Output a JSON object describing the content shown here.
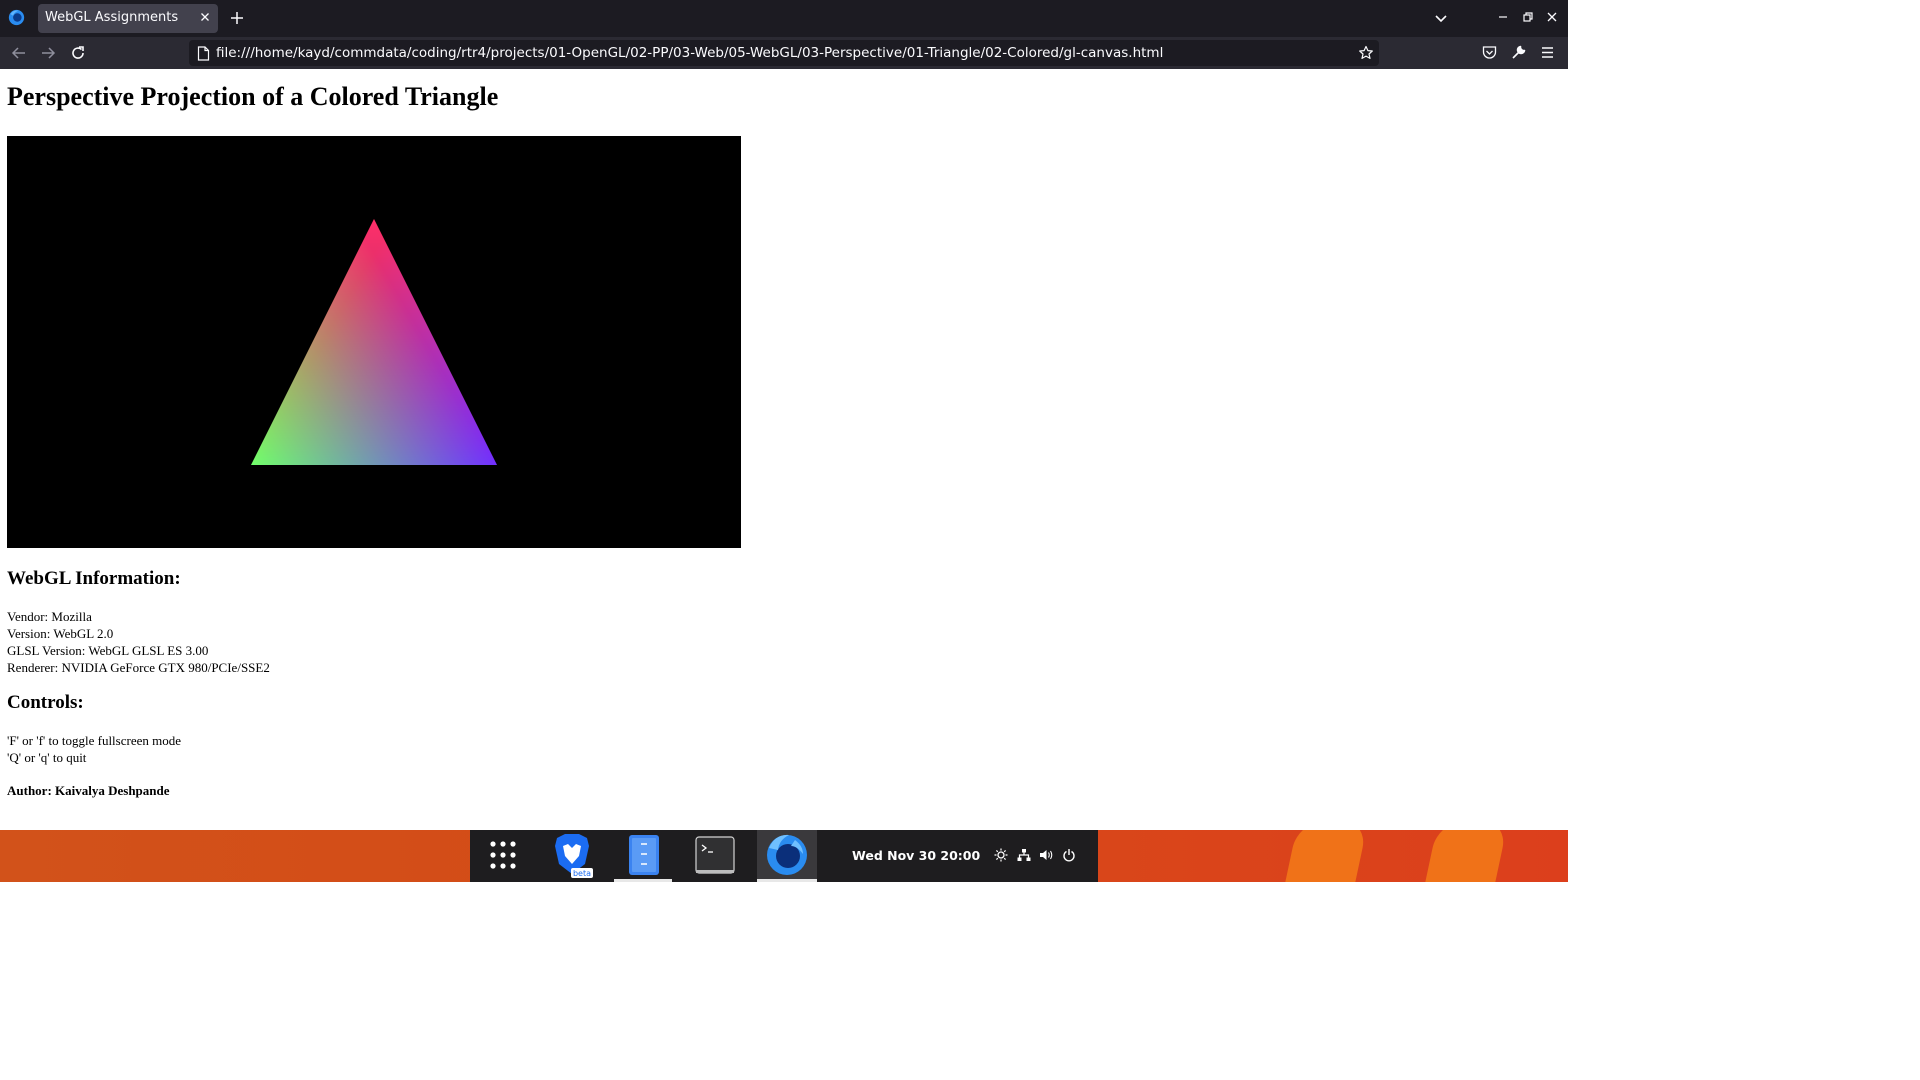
{
  "tab": {
    "title": "WebGL Assignments"
  },
  "navbar": {
    "url": "file:///home/kayd/commdata/coding/rtr4/projects/01-OpenGL/02-PP/03-Web/05-WebGL/03-Perspective/01-Triangle/02-Colored/gl-canvas.html"
  },
  "page": {
    "title": "Perspective Projection of a Colored Triangle",
    "canvas": {
      "background": "#000000",
      "vertex_colors": [
        "#ff0000",
        "#00ff00",
        "#0000ff"
      ]
    },
    "info_heading": "WebGL Information:",
    "info": {
      "vendor": "Vendor: Mozilla",
      "version": "Version: WebGL 2.0",
      "glsl": "GLSL Version: WebGL GLSL ES 3.00",
      "renderer": "Renderer: NVIDIA GeForce GTX 980/PCIe/SSE2"
    },
    "controls_heading": "Controls:",
    "controls": [
      "'F' or 'f' to toggle fullscreen mode",
      "'Q' or 'q' to quit"
    ],
    "author": "Author: Kaivalya Deshpande"
  },
  "taskbar": {
    "clock": "Wed Nov 30  20:00",
    "apps": [
      "apps-grid-icon",
      "brave-browser-icon",
      "file-manager-icon",
      "terminal-icon",
      "firefox-icon"
    ],
    "brave_badge": "beta"
  }
}
